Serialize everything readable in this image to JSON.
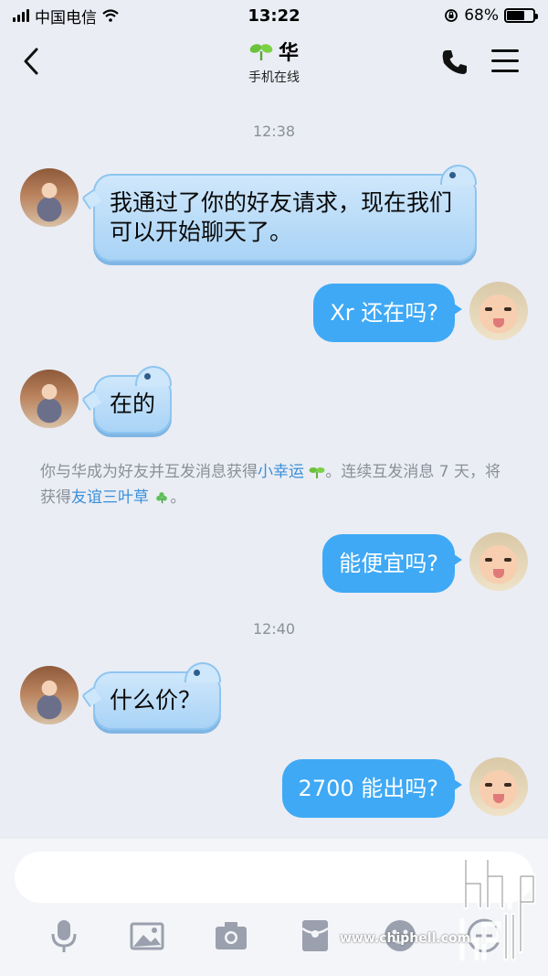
{
  "status_bar": {
    "carrier": "中国电信",
    "time": "13:22",
    "battery_percent": "68%",
    "battery_level": 0.68
  },
  "header": {
    "contact_name": "华",
    "subtitle": "手机在线"
  },
  "messages": {
    "ts1": "12:38",
    "m1": "我通过了你的好友请求，现在我们可以开始聊天了。",
    "m2": "Xr 还在吗?",
    "m3": "在的",
    "sys_part1": "你与华成为好友并互发消息获得",
    "sys_link1": "小幸运",
    "sys_part2": "。连续互发消息 7 天，将获得",
    "sys_link2": "友谊三叶草",
    "sys_part3": "。",
    "m4": "能便宜吗?",
    "ts2": "12:40",
    "m5": "什么价？",
    "m6": "2700 能出吗?"
  },
  "input": {
    "value": "",
    "placeholder": ""
  },
  "toolbar": {
    "icons": [
      "microphone-icon",
      "image-icon",
      "camera-icon",
      "red-packet-icon",
      "emoji-icon",
      "more-icon"
    ]
  },
  "watermark": {
    "text": "www.chiphell.com"
  },
  "colors": {
    "outgoing_bubble": "#3fa9f5",
    "incoming_bubble": "#b9dcf8",
    "link": "#3a8fd9",
    "background": "#eaedf4"
  }
}
